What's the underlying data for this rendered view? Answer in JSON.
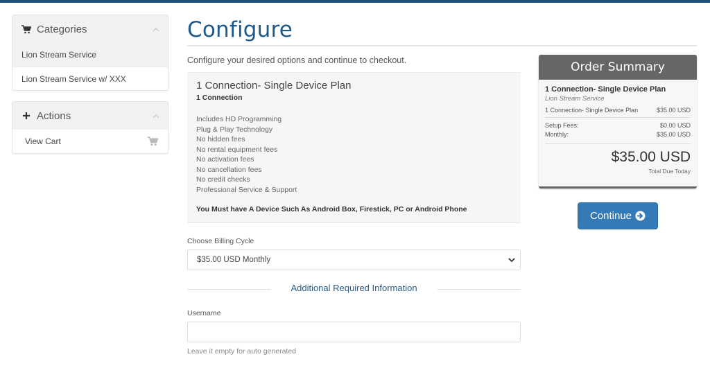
{
  "sidebar": {
    "categories": {
      "title": "Categories",
      "icon": "shopping-cart-icon",
      "items": [
        {
          "label": "Lion Stream Service",
          "active": true
        },
        {
          "label": "Lion Stream Service w/ XXX",
          "active": false
        }
      ]
    },
    "actions": {
      "title": "Actions",
      "icon": "plus-icon",
      "items": [
        {
          "label": "View Cart",
          "icon": "shopping-cart-icon"
        }
      ]
    }
  },
  "main": {
    "title": "Configure",
    "intro": "Configure your desired options and continue to checkout.",
    "product": {
      "name": "1 Connection- Single Device Plan",
      "subtitle": "1 Connection",
      "features": [
        "Includes HD Programming",
        "Plug & Play Technology",
        "No hidden fees",
        "No rental equipment fees",
        "No activation fees",
        "No cancellation fees",
        "No credit checks",
        "Professional Service & Support"
      ],
      "note": "You Must have A Device Such As Android Box, Firestick, PC or Android Phone"
    },
    "billing": {
      "label": "Choose Billing Cycle",
      "selected": "$35.00 USD Monthly"
    },
    "additional_info_heading": "Additional Required Information",
    "username": {
      "label": "Username",
      "value": "",
      "placeholder": "",
      "help": "Leave it empty for auto generated"
    }
  },
  "summary": {
    "title": "Order Summary",
    "product_name": "1 Connection- Single Device Plan",
    "product_group": "Lion Stream Service",
    "line_item": {
      "label": "1 Connection- Single Device Plan",
      "amount": "$35.00 USD"
    },
    "setup_fees": {
      "label": "Setup Fees:",
      "amount": "$0.00 USD"
    },
    "monthly": {
      "label": "Monthly:",
      "amount": "$35.00 USD"
    },
    "total": "$35.00 USD",
    "total_label": "Total Due Today"
  },
  "continue_button": {
    "label": "Continue",
    "icon": "arrow-circle-right-icon"
  },
  "colors": {
    "topbar": "#1a4f7a",
    "title": "#1d5a8a",
    "primary_button": "#337ab7",
    "summary_header": "#666666"
  }
}
